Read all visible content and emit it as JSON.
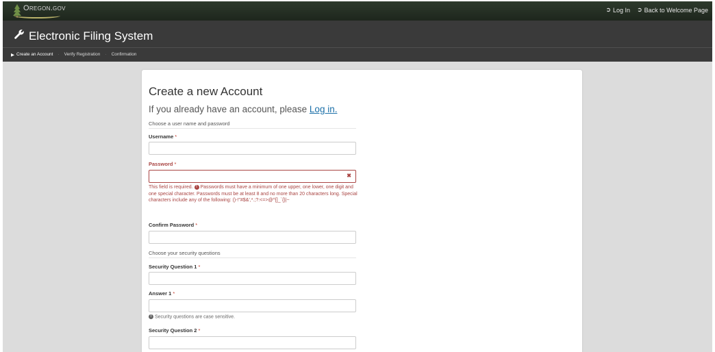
{
  "topbar": {
    "logo_text": "Oregon.gov",
    "login_label": "Log In",
    "back_label": "Back to Welcome Page"
  },
  "header": {
    "title": "Electronic Filing System",
    "steps": [
      "Create an Account",
      "Verify Registration",
      "Confirmation"
    ]
  },
  "form": {
    "heading": "Create a new Account",
    "login_prompt": "If you already have an account, please",
    "login_link": "Log in.",
    "section_credentials": "Choose a user name and password",
    "username_label": "Username",
    "password_label": "Password",
    "password_error_required": "This field is required.",
    "password_error_rules": "Passwords must have a minimum of one upper, one lower, one digit and one special character. Passwords must be at least 8 and no more than 20 characters long. Special characters include any of the following: ()-!\"#$&',*.;?:<=>@^[]_`{}|~",
    "confirm_password_label": "Confirm Password",
    "section_security": "Choose your security questions",
    "security_q1_label": "Security Question 1",
    "answer1_label": "Answer 1",
    "case_hint": "Security questions are case sensitive.",
    "security_q2_label": "Security Question 2",
    "required_mark": "*"
  },
  "colors": {
    "topbar_bg": "#1e261d",
    "header_bg": "#3a3a3a",
    "page_bg": "#dcdcdc",
    "error": "#a94442",
    "link": "#1a6fa8"
  }
}
